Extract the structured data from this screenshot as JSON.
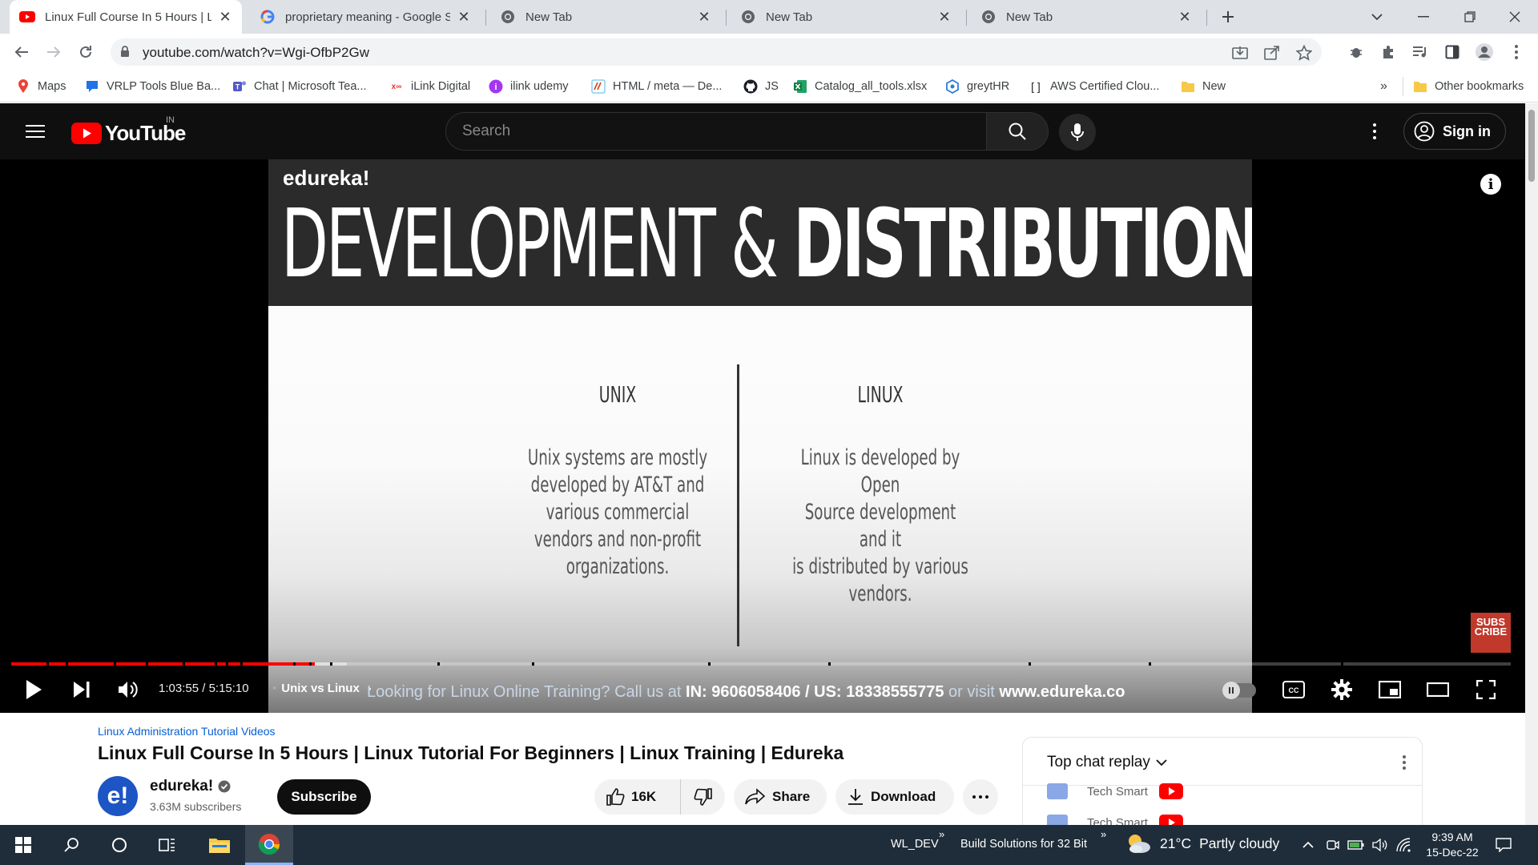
{
  "browser": {
    "tabs": [
      {
        "title": "Linux Full Course In 5 Hours | Lin",
        "favicon": "youtube-icon",
        "active": true
      },
      {
        "title": "proprietary meaning - Google Se",
        "favicon": "google-icon",
        "active": false
      },
      {
        "title": "New Tab",
        "favicon": "chrome-icon",
        "active": false
      },
      {
        "title": "New Tab",
        "favicon": "chrome-icon",
        "active": false
      },
      {
        "title": "New Tab",
        "favicon": "chrome-icon",
        "active": false
      }
    ],
    "url": "youtube.com/watch?v=Wgi-OfbP2Gw",
    "bookmarks": [
      {
        "label": "Maps",
        "icon": "maps-icon"
      },
      {
        "label": "VRLP Tools Blue Ba...",
        "icon": "tools-icon"
      },
      {
        "label": "Chat | Microsoft Tea...",
        "icon": "teams-icon"
      },
      {
        "label": "iLink Digital",
        "icon": "ilink-icon"
      },
      {
        "label": "ilink udemy",
        "icon": "udemy-icon"
      },
      {
        "label": "HTML / meta — De...",
        "icon": "mdn-icon"
      },
      {
        "label": "JS",
        "icon": "github-icon"
      },
      {
        "label": "Catalog_all_tools.xlsx",
        "icon": "excel-icon"
      },
      {
        "label": "greytHR",
        "icon": "greythr-icon"
      },
      {
        "label": "AWS Certified Clou...",
        "icon": "bracket-icon"
      },
      {
        "label": "New",
        "icon": "folder-icon"
      }
    ],
    "bookmarks_overflow": "»",
    "other_bookmarks": "Other bookmarks"
  },
  "youtube": {
    "logo_text": "YouTube",
    "country": "IN",
    "search_placeholder": "Search",
    "sign_in": "Sign in"
  },
  "player": {
    "slide": {
      "brand": "edureka!",
      "title_thin": "DEVELOPMENT & ",
      "title_bold": "DISTRIBUTION",
      "left_heading": "UNIX",
      "left_body": [
        "Unix systems are mostly",
        "developed by AT&T and",
        "various commercial",
        "vendors and non-profit",
        "organizations."
      ],
      "right_heading": "LINUX",
      "right_body": [
        "Linux is developed by Open",
        "Source development and it",
        "is distributed by various",
        "vendors."
      ]
    },
    "watermark": "SUBS CRIBE",
    "current_time": "1:03:55",
    "duration": "5:15:10",
    "time_separator": " / ",
    "chapter": "Unix vs Linux",
    "progress_played": 0.2027,
    "progress_loaded": 0.224,
    "ticker": {
      "prefix": "Looking for Linux Online Training? Call us at ",
      "phone_in": "IN: 9606058406 / US: 18338555775",
      "middle": " or visit ",
      "site": "www.edureka.co"
    },
    "controls": [
      "play-icon",
      "next-icon",
      "volume-icon",
      "captions-icon",
      "settings-icon",
      "miniplayer-icon",
      "theater-icon",
      "fullscreen-icon"
    ]
  },
  "video": {
    "hashtag": "Linux Administration Tutorial Videos",
    "title": "Linux Full Course In 5 Hours | Linux Tutorial For Beginners | Linux Training | Edureka",
    "channel": "edureka!",
    "channel_avatar": "e!",
    "subscribers": "3.63M subscribers",
    "subscribe": "Subscribe",
    "likes": "16K",
    "share": "Share",
    "download": "Download"
  },
  "chat": {
    "title": "Top chat replay",
    "rows": [
      "Tech Smart",
      "Tech Smart"
    ]
  },
  "taskbar": {
    "wl_dev": "WL_DEV",
    "build": "Build Solutions for 32 Bit",
    "overflow": "»",
    "temperature": "21°C",
    "weather": "Partly cloudy",
    "time": "9:39 AM",
    "date": "15-Dec-22"
  },
  "colors": {
    "youtube_red": "#ff0000",
    "progress": "#ff0000",
    "link_blue": "#065fd4",
    "taskbar": "#1f2d3a"
  }
}
